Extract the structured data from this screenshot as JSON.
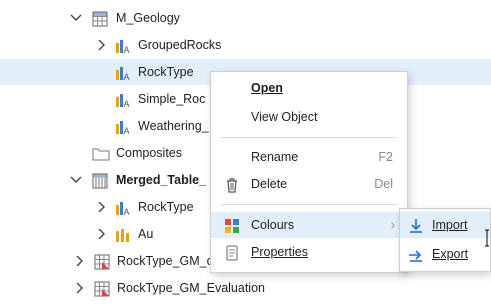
{
  "tree": {
    "m_geology": "M_Geology",
    "grouped_rocks": "GroupedRocks",
    "rock_type": "RockType",
    "simple_roc": "Simple_Roc",
    "weathering": "Weathering_",
    "composites": "Composites",
    "merged_table": "Merged_Table_",
    "merged_rocktype": "RockType",
    "au": "Au",
    "rocktype_gm_c": "RockType_GM_c",
    "rocktype_gm_eval": "RockType_GM_Evaluation"
  },
  "context_menu": {
    "open": "Open",
    "view_object": "View Object",
    "rename": "Rename",
    "rename_shortcut": "F2",
    "delete": "Delete",
    "delete_shortcut": "Del",
    "colours": "Colours",
    "properties": "Properties"
  },
  "submenu": {
    "import": "Import",
    "export": "Export"
  },
  "colors": {
    "selection": "#e3eefb",
    "accent": "#1f6fd1"
  }
}
